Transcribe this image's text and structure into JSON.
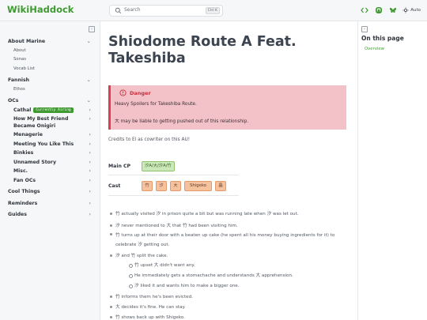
{
  "header": {
    "brand": "WikiHaddock",
    "search_placeholder": "Search",
    "search_shortcut": "Ctrl K",
    "theme_label": "Auto"
  },
  "sidebar": {
    "sections": [
      {
        "label": "About Marine",
        "subs": [
          "About",
          "Sonas",
          "Vocab List"
        ]
      },
      {
        "label": "Fannish",
        "subs": [
          "Ethos"
        ]
      }
    ],
    "ocs": {
      "label": "OCs",
      "children": [
        {
          "label": "Cathal",
          "badge": "Currently Airing"
        },
        {
          "label": "How My Best Friend Became Onigiri"
        },
        {
          "label": "Menagerie"
        },
        {
          "label": "Meeting You Like This"
        },
        {
          "label": "Binkies"
        },
        {
          "label": "Unnamed Story"
        },
        {
          "label": "Misc."
        },
        {
          "label": "Fan OCs"
        }
      ]
    },
    "tail": [
      "Cool Things",
      "Reminders",
      "Guides"
    ]
  },
  "toc": {
    "title": "On this page",
    "items": [
      "Overview"
    ]
  },
  "page": {
    "title": "Shiodome Route A Feat. Takeshiba",
    "danger": {
      "heading": "Danger",
      "line1": "Heavy Spoilers for Takeshiba Route.",
      "line2": "大 may be liable to getting pushed out of this relationship."
    },
    "credits": "Credits to El as cowriter on this AU!",
    "main_cp": {
      "label": "Main CP",
      "value": "汐A/大/汐A/竹"
    },
    "cast": {
      "label": "Cast",
      "members": [
        "竹",
        "汐",
        "大",
        "Shigeko",
        "晶"
      ]
    },
    "bullets": [
      "竹 actually visited 汐 in prison quite a bit but was running late when 汐 was let out.",
      "汐 never mentioned to 大 that 竹 had been visiting him.",
      "竹 turns up at their door with a beaten up cake (he spent all his money buying ingredients for it) to celebrate 汐 getting out.",
      "汐 and 竹 split the cake.",
      "竹 upset 大 didn't want any.",
      "He immediately gets a stomachache and understands 大 apprehension.",
      "汐 liked it and wants him to make a bigger one.",
      "竹 informs them he's been evicted.",
      "大 decides it's fine. He can stay.",
      "竹 shows back up with Shigeko."
    ]
  }
}
